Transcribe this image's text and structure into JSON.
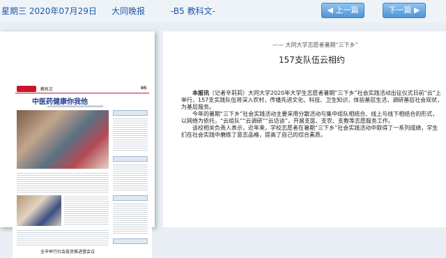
{
  "topbar": {
    "date": "星期三 2020年07月29日",
    "paper": "大同晚报",
    "section": "-B5 教科文-",
    "prev_label": "上一篇",
    "next_label": "下一篇"
  },
  "thumbnail": {
    "section": "教科文",
    "page_num": "05",
    "headline": "中医药健康你我他",
    "foot": "全市举行社会投资推进暨会议"
  },
  "article": {
    "kicker": "—— 大同大学志愿者暑期“三下乡”",
    "title": "157支队伍云相约",
    "lead": "本报讯",
    "p1": "（记者辛莉莉）大同大学2020年大学生志愿者暑期“三下乡”社会实践活动出征仪式日前“云”上举行，157支实践队伍将深入农村，传播先进文化、科技、卫生知识，体验基层生活，调研基层社会现状，为基层服务。",
    "p2": "今年的暑期“三下乡”社会实践活动主要采用分散活动与集中组队相结合、线上与线下相结合的形式，以网络为依托，“云组队”“云调研”“云访谈”，开展支医、支农、支教等志愿服务工作。",
    "p3": "该校相关负责人表示，近年来，学校志愿者在暑期“三下乡”社会实践活动中取得了一系列成绩，学生们在社会实践中磨练了意志品格，提高了自己的综合素质。"
  }
}
